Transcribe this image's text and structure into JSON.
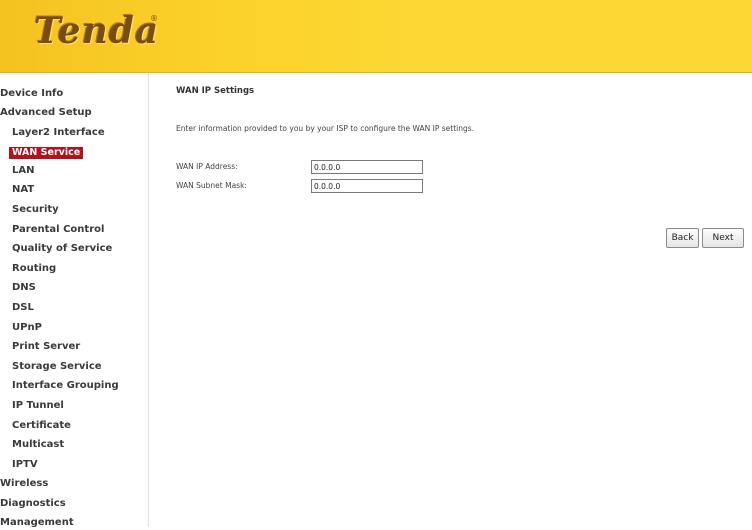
{
  "header": {
    "logo_text": "Tenda",
    "logo_mark": "®",
    "background_color": "#fdd835"
  },
  "sidebar": {
    "active_color": "#b2121e",
    "items": [
      {
        "label": "Device Info"
      },
      {
        "label": "Advanced Setup"
      },
      {
        "label": "Layer2 Interface"
      },
      {
        "label": "WAN Service"
      },
      {
        "label": "LAN"
      },
      {
        "label": "NAT"
      },
      {
        "label": "Security"
      },
      {
        "label": "Parental Control"
      },
      {
        "label": "Quality of Service"
      },
      {
        "label": "Routing"
      },
      {
        "label": "DNS"
      },
      {
        "label": "DSL"
      },
      {
        "label": "UPnP"
      },
      {
        "label": "Print Server"
      },
      {
        "label": "Storage Service"
      },
      {
        "label": "Interface Grouping"
      },
      {
        "label": "IP Tunnel"
      },
      {
        "label": "Certificate"
      },
      {
        "label": "Multicast"
      },
      {
        "label": "IPTV"
      },
      {
        "label": "Wireless"
      },
      {
        "label": "Diagnostics"
      },
      {
        "label": "Management"
      }
    ]
  },
  "main": {
    "title": "WAN IP Settings",
    "description": "Enter information provided to you by your ISP to configure the WAN IP settings.",
    "fields": [
      {
        "label": "WAN IP Address:",
        "value": "0.0.0.0"
      },
      {
        "label": "WAN Subnet Mask:",
        "value": "0.0.0.0"
      }
    ],
    "buttons": {
      "back": "Back",
      "next": "Next"
    }
  }
}
